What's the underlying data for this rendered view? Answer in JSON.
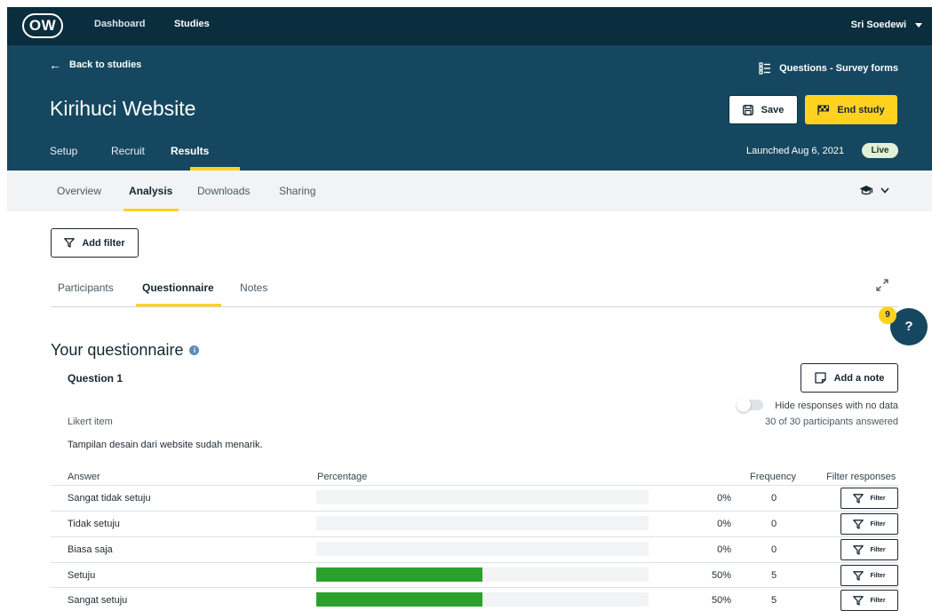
{
  "topnav": {
    "logo": "OW",
    "links": [
      "Dashboard",
      "Studies"
    ],
    "active_link": "Studies",
    "user_name": "Sri Soedewi"
  },
  "study": {
    "back_label": "Back to studies",
    "question_type": "Questions - Survey forms",
    "title": "Kirihuci Website",
    "save_label": "Save",
    "end_label": "End study",
    "tabs": [
      "Setup",
      "Recruit",
      "Results"
    ],
    "active_tab": "Results",
    "launched": "Launched Aug 6, 2021",
    "status": "Live"
  },
  "results_nav": {
    "tabs": [
      "Overview",
      "Analysis",
      "Downloads",
      "Sharing"
    ],
    "active_tab": "Analysis"
  },
  "filter": {
    "add_filter_label": "Add filter"
  },
  "result_tabs": {
    "tabs": [
      "Participants",
      "Questionnaire",
      "Notes"
    ],
    "active_tab": "Questionnaire"
  },
  "help": {
    "label": "?",
    "count": "9"
  },
  "questionnaire": {
    "title": "Your questionnaire",
    "question": {
      "title": "Question 1",
      "add_note_label": "Add a note",
      "hide_label": "Hide responses with no data",
      "answered": "30 of 30 participants answered",
      "type": "Likert item",
      "text": "Tampilan desain dari website sudah menarik.",
      "columns": {
        "answer": "Answer",
        "percentage": "Percentage",
        "frequency": "Frequency",
        "filter": "Filter responses"
      },
      "filter_button_label": "Filter",
      "rows": [
        {
          "answer": "Sangat tidak setuju",
          "percent_label": "0%",
          "percent": 0,
          "frequency": "0"
        },
        {
          "answer": "Tidak setuju",
          "percent_label": "0%",
          "percent": 0,
          "frequency": "0"
        },
        {
          "answer": "Biasa saja",
          "percent_label": "0%",
          "percent": 0,
          "frequency": "0"
        },
        {
          "answer": "Setuju",
          "percent_label": "50%",
          "percent": 50,
          "frequency": "5"
        },
        {
          "answer": "Sangat setuju",
          "percent_label": "50%",
          "percent": 50,
          "frequency": "5"
        }
      ]
    }
  },
  "colors": {
    "nav_bg": "#0a2e3e",
    "header_bg": "#154860",
    "accent": "#ffd21f",
    "bar_fill": "#2aa22a"
  }
}
